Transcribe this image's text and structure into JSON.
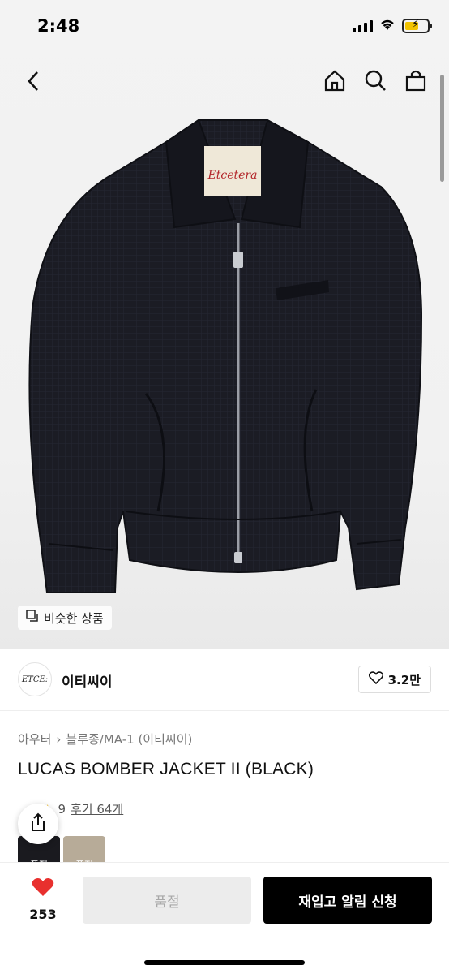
{
  "status_bar": {
    "time": "2:48"
  },
  "hero": {
    "similar_label": "비슷한 상품"
  },
  "brand": {
    "logo_text": "ETCE:",
    "name": "이티씨이",
    "likes": "3.2만"
  },
  "breadcrumb": [
    "아우터",
    "블루종/MA-1 (이티씨이)"
  ],
  "product": {
    "title": "LUCAS BOMBER JACKET II (BLACK)"
  },
  "reviews": {
    "rating_partial": "9",
    "review_label": "후기 64개"
  },
  "swatches": [
    {
      "label": "품절"
    },
    {
      "label": "품절"
    }
  ],
  "bottom": {
    "wish_count": "253",
    "soldout_label": "품절",
    "restock_label": "재입고 알림 신청"
  },
  "colors": {
    "accent_red": "#e8302e",
    "black": "#000000",
    "jacket": "#1b1c24"
  },
  "icons": [
    "back-icon",
    "home-icon",
    "search-icon",
    "bag-icon",
    "heart-icon",
    "share-icon"
  ]
}
